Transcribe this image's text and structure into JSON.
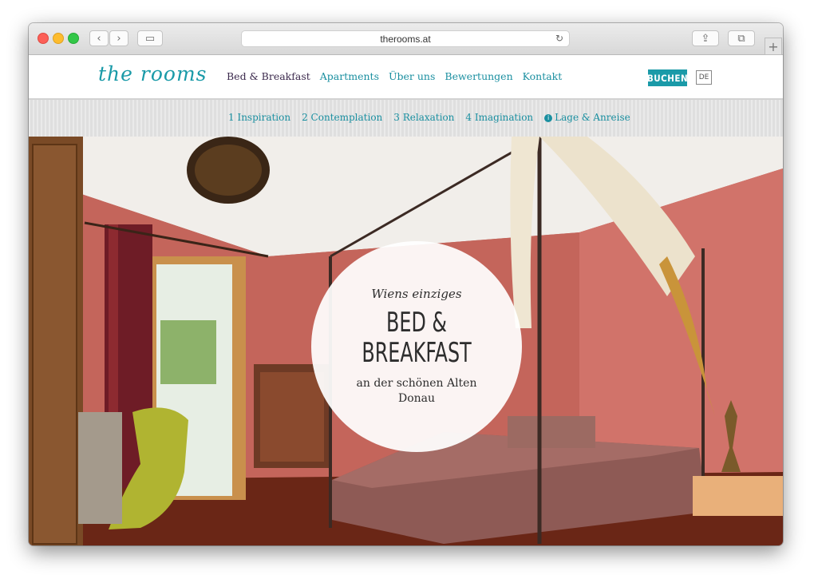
{
  "browser": {
    "url": "therooms.at",
    "back_icon": "‹",
    "forward_icon": "›",
    "sidebar_icon": "▭",
    "reload_icon": "↻",
    "share_icon": "⇪",
    "tabs_icon": "⧉",
    "new_tab_icon": "+"
  },
  "site": {
    "logo": "the rooms",
    "nav": [
      "Bed & Breakfast",
      "Apartments",
      "Über uns",
      "Bewertungen",
      "Kontakt"
    ],
    "book_label": "BUCHEN",
    "lang_label": "DE",
    "subnav": [
      "1 Inspiration",
      "2 Contemplation",
      "3 Relaxation",
      "4 Imagination"
    ],
    "location_label": "Lage & Anreise",
    "info_icon": "i"
  },
  "hero": {
    "intro": "Wiens einziges",
    "headline_1": "BED &",
    "headline_2": "BREAKFAST",
    "subline": "an der schönen Alten Donau"
  },
  "colors": {
    "accent": "#1a9aa8",
    "nav_active": "#3c2a4d",
    "wall": "#b8625a"
  }
}
